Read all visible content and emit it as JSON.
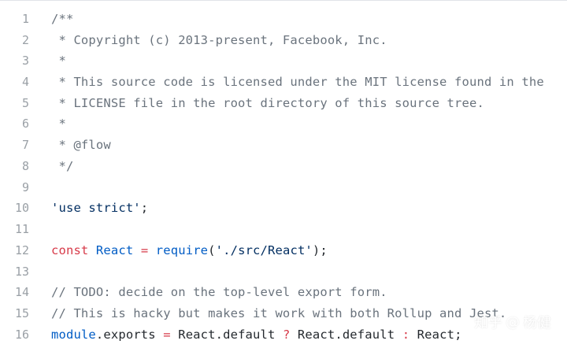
{
  "code_lines": [
    {
      "number": "1",
      "tokens": [
        {
          "text": "/**",
          "kind": "comment"
        }
      ]
    },
    {
      "number": "2",
      "tokens": [
        {
          "text": " * Copyright (c) 2013-present, Facebook, Inc.",
          "kind": "comment"
        }
      ]
    },
    {
      "number": "3",
      "tokens": [
        {
          "text": " *",
          "kind": "comment"
        }
      ]
    },
    {
      "number": "4",
      "tokens": [
        {
          "text": " * This source code is licensed under the MIT license found in the",
          "kind": "comment"
        }
      ]
    },
    {
      "number": "5",
      "tokens": [
        {
          "text": " * LICENSE file in the root directory of this source tree.",
          "kind": "comment"
        }
      ]
    },
    {
      "number": "6",
      "tokens": [
        {
          "text": " *",
          "kind": "comment"
        }
      ]
    },
    {
      "number": "7",
      "tokens": [
        {
          "text": " * @flow",
          "kind": "comment"
        }
      ]
    },
    {
      "number": "8",
      "tokens": [
        {
          "text": " */",
          "kind": "comment"
        }
      ]
    },
    {
      "number": "9",
      "tokens": []
    },
    {
      "number": "10",
      "tokens": [
        {
          "text": "'use strict'",
          "kind": "string"
        },
        {
          "text": ";",
          "kind": "plain"
        }
      ]
    },
    {
      "number": "11",
      "tokens": []
    },
    {
      "number": "12",
      "tokens": [
        {
          "text": "const",
          "kind": "keyword"
        },
        {
          "text": " ",
          "kind": "plain"
        },
        {
          "text": "React",
          "kind": "identifier"
        },
        {
          "text": " ",
          "kind": "plain"
        },
        {
          "text": "=",
          "kind": "keyword"
        },
        {
          "text": " ",
          "kind": "plain"
        },
        {
          "text": "require",
          "kind": "identifier"
        },
        {
          "text": "(",
          "kind": "plain"
        },
        {
          "text": "'./src/React'",
          "kind": "string"
        },
        {
          "text": ");",
          "kind": "plain"
        }
      ]
    },
    {
      "number": "13",
      "tokens": []
    },
    {
      "number": "14",
      "tokens": [
        {
          "text": "// TODO: decide on the top-level export form.",
          "kind": "comment"
        }
      ]
    },
    {
      "number": "15",
      "tokens": [
        {
          "text": "// This is hacky but makes it work with both Rollup and Jest.",
          "kind": "comment"
        }
      ]
    },
    {
      "number": "16",
      "tokens": [
        {
          "text": "module",
          "kind": "identifier"
        },
        {
          "text": ".exports ",
          "kind": "plain"
        },
        {
          "text": "=",
          "kind": "keyword"
        },
        {
          "text": " React.default ",
          "kind": "plain"
        },
        {
          "text": "?",
          "kind": "keyword"
        },
        {
          "text": " React.default ",
          "kind": "plain"
        },
        {
          "text": ":",
          "kind": "keyword"
        },
        {
          "text": " React;",
          "kind": "plain"
        }
      ]
    }
  ],
  "watermark": {
    "site": "知乎",
    "separator": "@",
    "author": "杨健"
  }
}
